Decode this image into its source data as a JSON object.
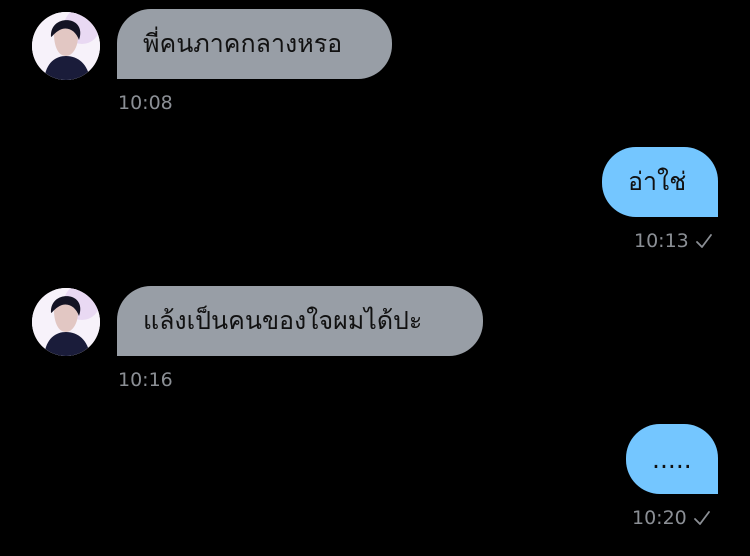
{
  "messages": [
    {
      "direction": "incoming",
      "text": "พี่คนภาคกลางหรอ",
      "time": "10:08"
    },
    {
      "direction": "outgoing",
      "text": "อ่าใช่",
      "time": "10:13",
      "status_icon": "check-icon"
    },
    {
      "direction": "incoming",
      "text": "แล้งเป็นคนของใจผมได้ปะ",
      "time": "10:16"
    },
    {
      "direction": "outgoing",
      "text": ".....",
      "time": "10:20",
      "status_icon": "check-icon"
    }
  ],
  "colors": {
    "background": "#000000",
    "incoming_bubble": "#989ea6",
    "outgoing_bubble": "#74c6ff",
    "timestamp": "#8b8f95"
  }
}
